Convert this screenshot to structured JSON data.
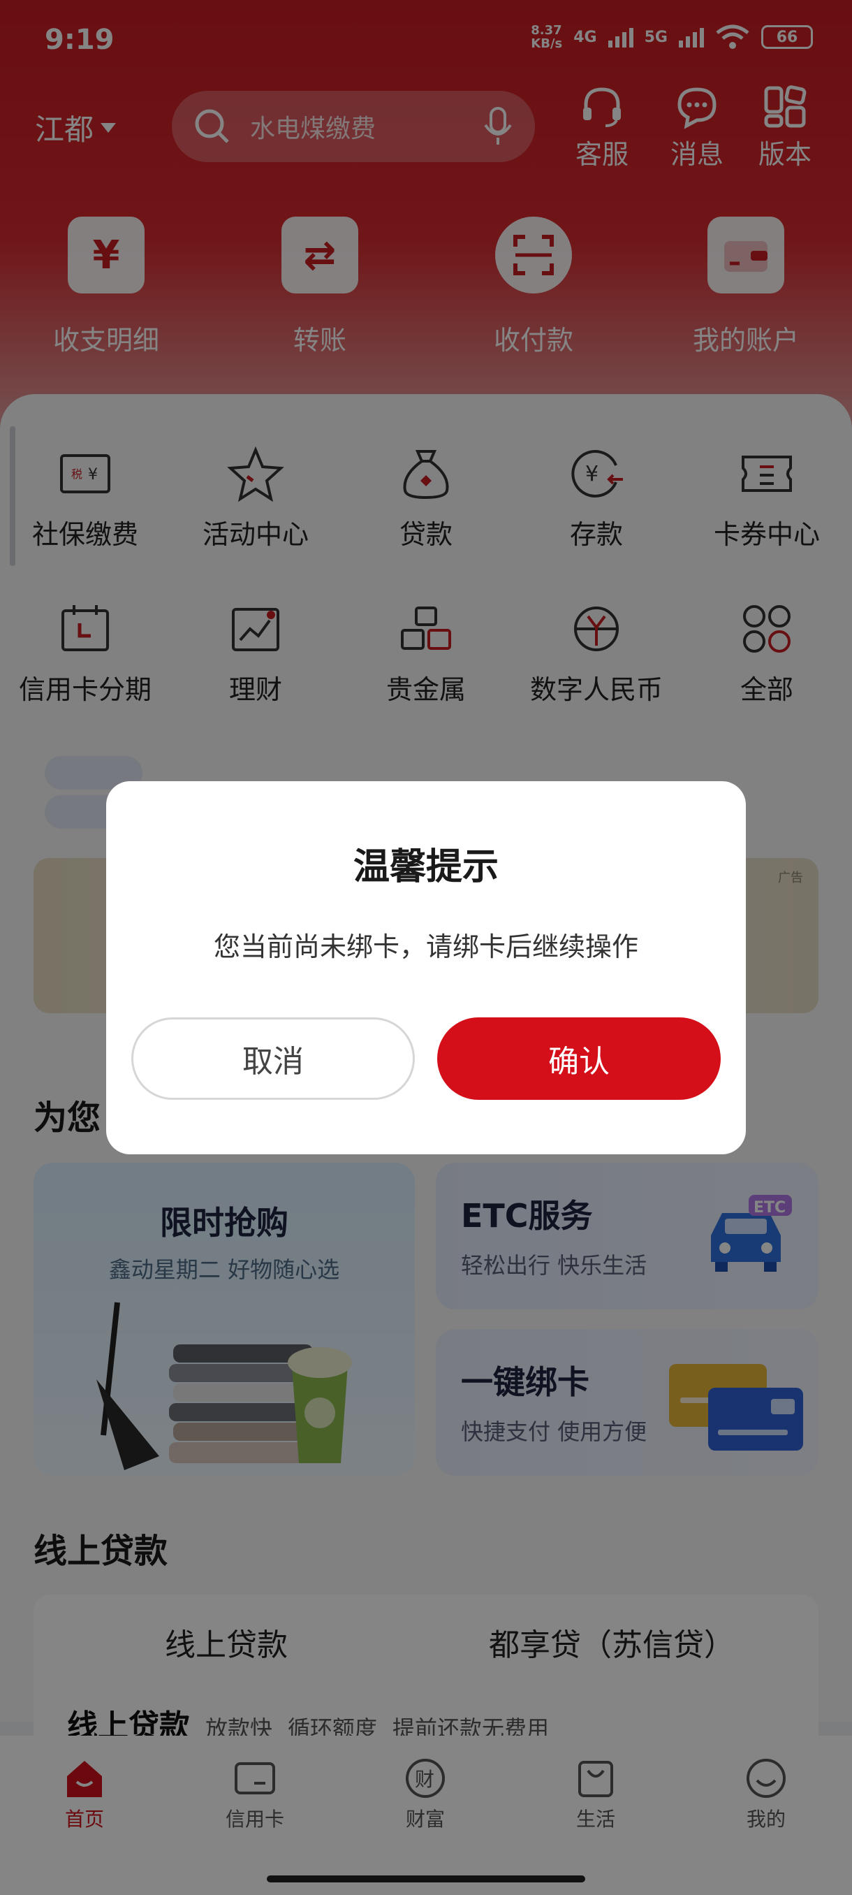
{
  "status": {
    "time": "9:19",
    "speed_top": "8.37",
    "speed_bottom": "KB/s",
    "net1": "4G",
    "net2": "5G",
    "battery": "66"
  },
  "header": {
    "city": "江都",
    "search_placeholder": "水电煤缴费",
    "actions": [
      "客服",
      "消息",
      "版本"
    ],
    "quick": [
      "收支明细",
      "转账",
      "收付款",
      "我的账户"
    ]
  },
  "grid": {
    "row1": [
      "社保缴费",
      "活动中心",
      "贷款",
      "存款",
      "卡券中心"
    ],
    "row2": [
      "信用卡分期",
      "理财",
      "贵金属",
      "数字人民币",
      "全部"
    ]
  },
  "banner": {
    "ad_tag": "广告"
  },
  "recommend": {
    "title_partial": "为您",
    "flash": {
      "title": "限时抢购",
      "subtitle": "鑫动星期二 好物随心选"
    },
    "etc": {
      "title": "ETC服务",
      "subtitle": "轻松出行 快乐生活",
      "badge": "ETC"
    },
    "bind": {
      "title": "一键绑卡",
      "subtitle": "快捷支付 使用方便"
    }
  },
  "loan": {
    "section_title": "线上贷款",
    "tabs": [
      "线上贷款",
      "都享贷（苏信贷）"
    ],
    "line_title": "线上贷款",
    "tags": [
      "放款快",
      "循环额度",
      "提前还款无费用"
    ]
  },
  "tabbar": [
    "首页",
    "信用卡",
    "财富",
    "生活",
    "我的"
  ],
  "dialog": {
    "title": "温馨提示",
    "message": "您当前尚未绑卡，请绑卡后继续操作",
    "cancel": "取消",
    "confirm": "确认"
  },
  "colors": {
    "brand_red": "#d50f19",
    "header_red": "#c81d24"
  }
}
